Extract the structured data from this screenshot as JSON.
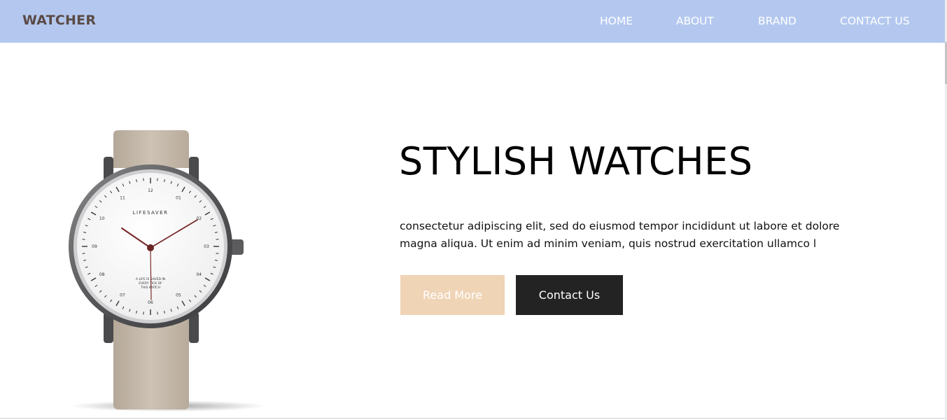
{
  "nav": {
    "brand": "WATCHER",
    "links": [
      "HOME",
      "ABOUT",
      "BRAND",
      "CONTACT US"
    ]
  },
  "hero": {
    "title": "STYLISH WATCHES",
    "text": "consectetur adipiscing elit, sed do eiusmod tempor incididunt ut labore et dolore magna aliqua. Ut enim ad minim veniam, quis nostrud exercitation ullamco l",
    "read_more_label": "Read More",
    "contact_label": "Contact Us"
  },
  "watch": {
    "brand_text": "LIFESAVER",
    "tagline_lines": [
      "A LIFE IS SAVED IN",
      "EVERY TICK OF",
      "THIS WATCH"
    ],
    "hour_numbers": [
      "12",
      "01",
      "02",
      "03",
      "04",
      "05",
      "06",
      "07",
      "08",
      "09",
      "10",
      "11"
    ]
  },
  "colors": {
    "nav_bg": "#b4c8ef",
    "brand": "#5a4a46",
    "read_more_bg": "#f0d4b6",
    "contact_bg": "#232323",
    "strap": "#c8bcad",
    "hands": "#7a2a2a"
  }
}
